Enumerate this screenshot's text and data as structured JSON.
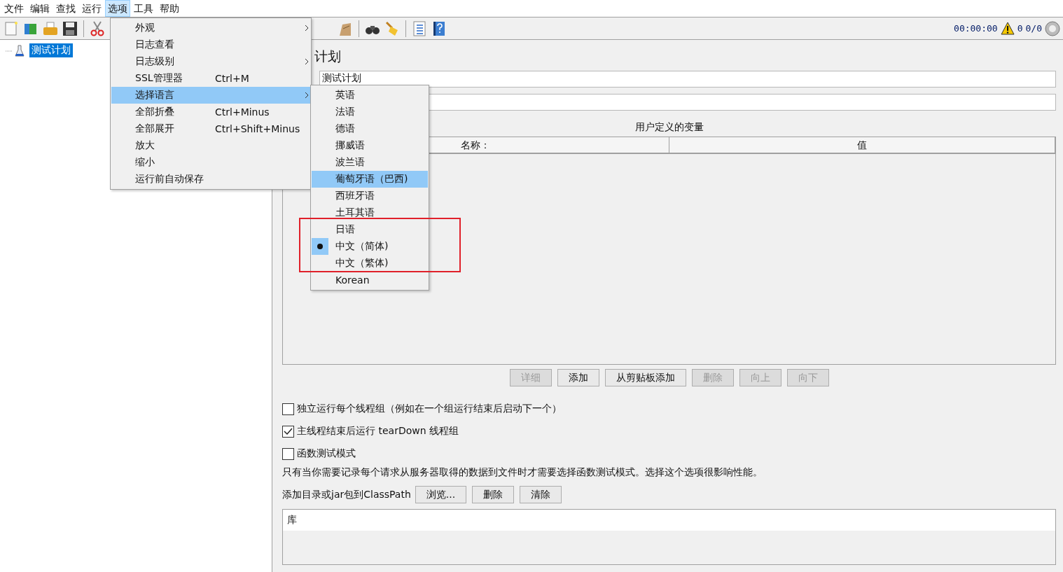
{
  "menubar": [
    {
      "label": "文件",
      "selected": false
    },
    {
      "label": "编辑",
      "selected": false
    },
    {
      "label": "查找",
      "selected": false
    },
    {
      "label": "运行",
      "selected": false
    },
    {
      "label": "选项",
      "selected": true
    },
    {
      "label": "工具",
      "selected": false
    },
    {
      "label": "帮助",
      "selected": false
    }
  ],
  "status": {
    "timer": "00:00:00",
    "warning_count": "0",
    "threads": "0/0"
  },
  "tree": [
    {
      "label": "测试计划",
      "selected": true
    }
  ],
  "panel": {
    "title": "计划",
    "name_value": "测试计划",
    "variables_title": "用户定义的变量",
    "columns": [
      "名称：",
      "值"
    ],
    "buttons": [
      {
        "label": "详细",
        "disabled": true
      },
      {
        "label": "添加",
        "disabled": false
      },
      {
        "label": "从剪贴板添加",
        "disabled": false
      },
      {
        "label": "删除",
        "disabled": true
      },
      {
        "label": "向上",
        "disabled": true
      },
      {
        "label": "向下",
        "disabled": true
      }
    ],
    "options": [
      {
        "label": "独立运行每个线程组（例如在一个组运行结束后启动下一个）",
        "checked": false
      },
      {
        "label": "主线程结束后运行 tearDown 线程组",
        "checked": true
      },
      {
        "label": "函数测试模式",
        "checked": false
      }
    ],
    "note": "只有当你需要记录每个请求从服务器取得的数据到文件时才需要选择函数测试模式。选择这个选项很影响性能。",
    "classpath_label": "添加目录或jar包到ClassPath",
    "classpath_buttons": [
      "浏览...",
      "删除",
      "清除"
    ],
    "library_column": "库"
  },
  "options_menu": [
    {
      "label": "外观",
      "submenu": true,
      "selected": false
    },
    {
      "label": "日志查看",
      "submenu": false,
      "selected": false
    },
    {
      "label": "日志级别",
      "submenu": true,
      "selected": false
    },
    {
      "label": "SSL管理器",
      "shortcut": "Ctrl+M",
      "submenu": false,
      "selected": false
    },
    {
      "label": "选择语言",
      "submenu": true,
      "selected": true
    },
    {
      "label": "全部折叠",
      "shortcut": "Ctrl+Minus",
      "submenu": false,
      "selected": false
    },
    {
      "label": "全部展开",
      "shortcut": "Ctrl+Shift+Minus",
      "submenu": false,
      "selected": false
    },
    {
      "label": "放大",
      "submenu": false,
      "selected": false
    },
    {
      "label": "缩小",
      "submenu": false,
      "selected": false
    },
    {
      "label": "运行前自动保存",
      "submenu": false,
      "selected": false
    }
  ],
  "language_menu": [
    {
      "label": "英语",
      "selected": false,
      "checked": false
    },
    {
      "label": "法语",
      "selected": false,
      "checked": false
    },
    {
      "label": "德语",
      "selected": false,
      "checked": false
    },
    {
      "label": "挪威语",
      "selected": false,
      "checked": false
    },
    {
      "label": "波兰语",
      "selected": false,
      "checked": false
    },
    {
      "label": "葡萄牙语（巴西)",
      "selected": true,
      "checked": false
    },
    {
      "label": "西班牙语",
      "selected": false,
      "checked": false
    },
    {
      "label": "土耳其语",
      "selected": false,
      "checked": false
    },
    {
      "label": "日语",
      "selected": false,
      "checked": false
    },
    {
      "label": "中文（简体)",
      "selected": false,
      "checked": true
    },
    {
      "label": "中文（繁体)",
      "selected": false,
      "checked": false
    },
    {
      "label": "Korean",
      "selected": false,
      "checked": false
    }
  ]
}
